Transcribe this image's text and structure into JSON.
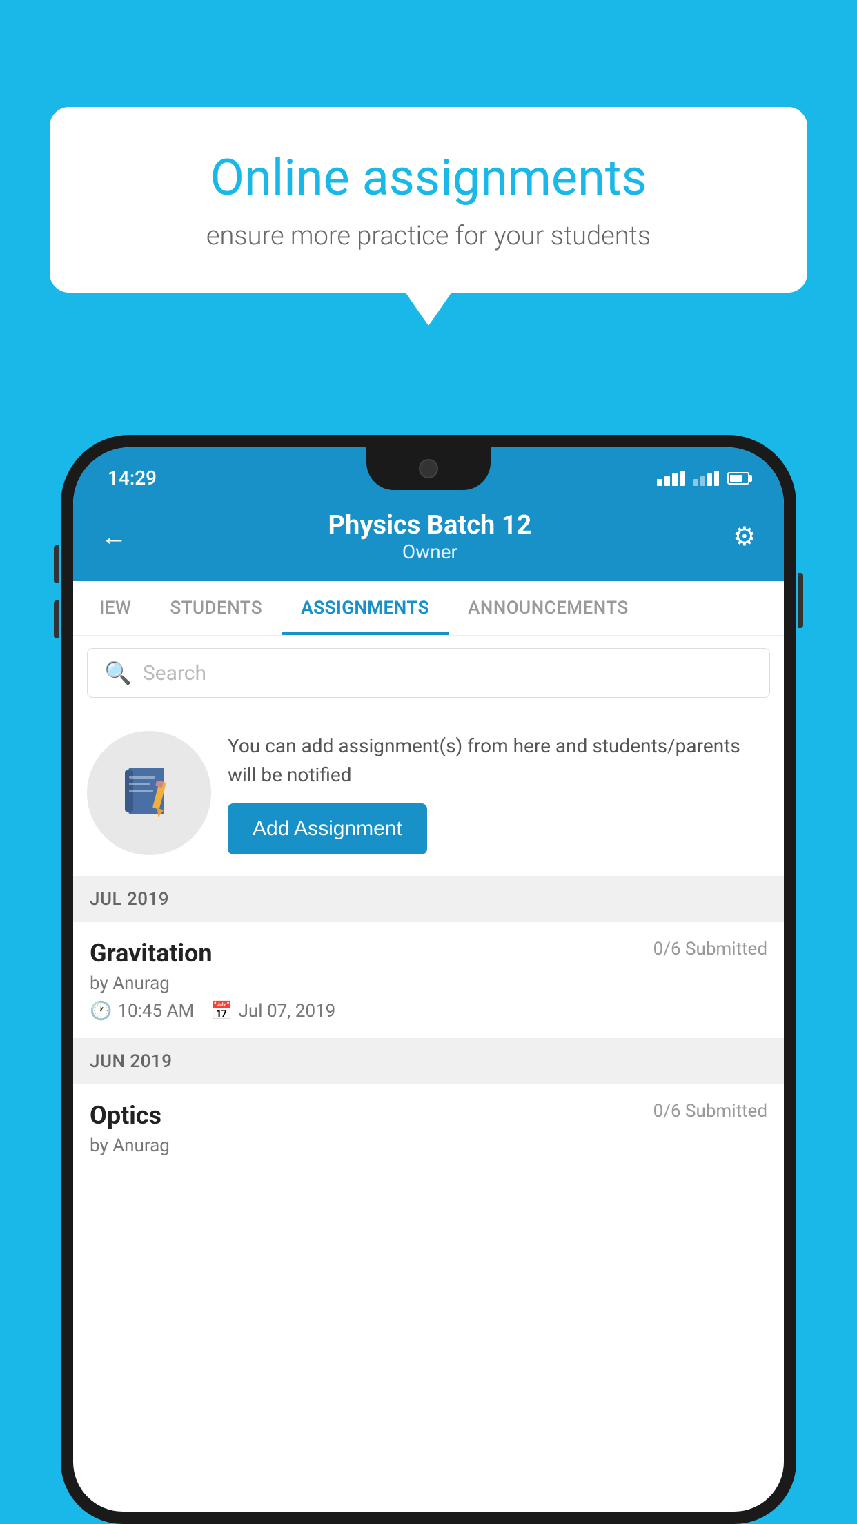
{
  "background_color": "#1ab8e8",
  "speech_bubble": {
    "title": "Online assignments",
    "subtitle": "ensure more practice for your students"
  },
  "phone": {
    "status_bar": {
      "time": "14:29"
    },
    "header": {
      "title": "Physics Batch 12",
      "subtitle": "Owner",
      "back_label": "←",
      "settings_label": "⚙"
    },
    "tabs": [
      {
        "label": "IEW",
        "active": false
      },
      {
        "label": "STUDENTS",
        "active": false
      },
      {
        "label": "ASSIGNMENTS",
        "active": true
      },
      {
        "label": "ANNOUNCEMENTS",
        "active": false
      }
    ],
    "search": {
      "placeholder": "Search"
    },
    "add_assignment": {
      "info_text": "You can add assignment(s) from here and students/parents will be notified",
      "button_label": "Add Assignment"
    },
    "sections": [
      {
        "header": "JUL 2019",
        "items": [
          {
            "name": "Gravitation",
            "submitted": "0/6 Submitted",
            "by": "by Anurag",
            "time": "10:45 AM",
            "date": "Jul 07, 2019"
          }
        ]
      },
      {
        "header": "JUN 2019",
        "items": [
          {
            "name": "Optics",
            "submitted": "0/6 Submitted",
            "by": "by Anurag",
            "time": "",
            "date": ""
          }
        ]
      }
    ]
  }
}
